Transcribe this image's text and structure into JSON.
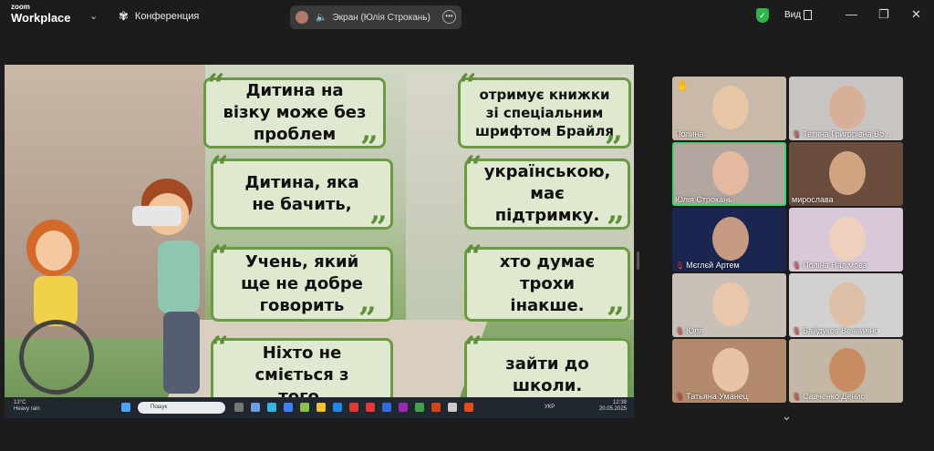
{
  "topbar": {
    "brand_small": "zoom",
    "brand": "Workplace",
    "meeting_label": "Конференция",
    "share_label": "Экран (Юлія Строкань)",
    "view_label": "Вид"
  },
  "slide": {
    "cards": [
      {
        "text": "Дитина на візку може без проблем"
      },
      {
        "text": "отримує книжки зі спеціальним шрифтом Брайля"
      },
      {
        "text": "Дитина, яка не бачить,"
      },
      {
        "text": "українською, має підтримку."
      },
      {
        "text": "Учень, який ще не добре говорить"
      },
      {
        "text": "хто думає трохи інакше."
      },
      {
        "text": "Ніхто не сміється з того,"
      },
      {
        "text": "зайти до школи."
      }
    ]
  },
  "taskbar": {
    "temp": "13°C",
    "weather": "Heavy rain",
    "search": "Пошук",
    "lang": "УКР",
    "time": "12:39",
    "date": "20.05.2025"
  },
  "participants": [
    {
      "name": "Полина",
      "muted": false,
      "hand": true
    },
    {
      "name": "Тетяна Григорівна Во...",
      "muted": true
    },
    {
      "name": "Юлія Строкань",
      "muted": false,
      "active": true
    },
    {
      "name": "мирослава",
      "muted": false
    },
    {
      "name": "Мєглєй Артем",
      "muted": true
    },
    {
      "name": "Поліна Налімова",
      "muted": true
    },
    {
      "name": "Юля",
      "muted": true
    },
    {
      "name": "Байдуков Веніаміно",
      "muted": true
    },
    {
      "name": "Татьяна Уманец",
      "muted": true
    },
    {
      "name": "Савченко Денис",
      "muted": true
    }
  ],
  "colors": {
    "accent_green": "#3fd16a",
    "card_border": "#6c9a44",
    "quote": "#5f8f3a",
    "muted_red": "#e04848"
  }
}
